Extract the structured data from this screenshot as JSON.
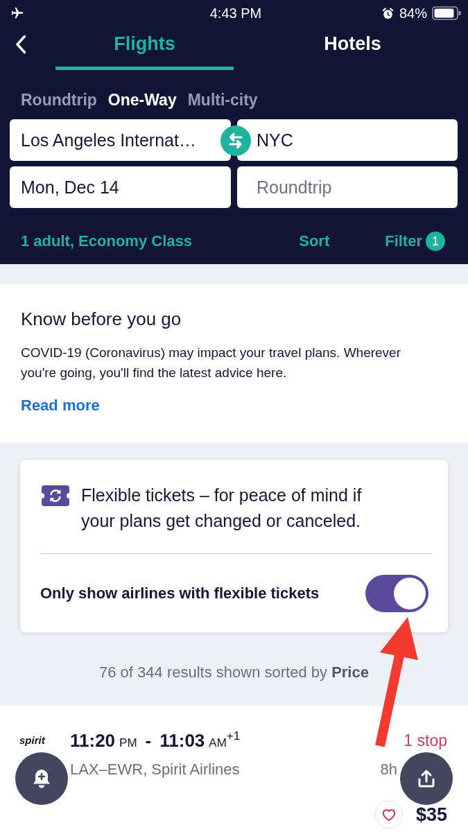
{
  "status_bar": {
    "time": "4:43 PM",
    "battery": "84%"
  },
  "header": {
    "tabs": [
      {
        "label": "Flights",
        "selected": true
      },
      {
        "label": "Hotels",
        "selected": false
      }
    ],
    "trip_types": [
      {
        "label": "Roundtrip",
        "selected": false
      },
      {
        "label": "One-Way",
        "selected": true
      },
      {
        "label": "Multi-city",
        "selected": false
      }
    ],
    "fields": {
      "origin": {
        "value": "Los Angeles Internat…"
      },
      "destination": {
        "value": "NYC"
      },
      "depart_date": {
        "value": "Mon, Dec 14"
      },
      "return_date": {
        "placeholder": "Roundtrip"
      }
    },
    "passengers": "1 adult, Economy Class",
    "sort": "Sort",
    "filter": {
      "label": "Filter",
      "count": "1"
    }
  },
  "notice": {
    "title": "Know before you go",
    "body": "COVID-19 (Coronavirus) may impact your travel plans. Wherever you're going, you'll find the latest advice here.",
    "link": "Read more"
  },
  "flexible_tickets": {
    "text": "Flexible tickets – for peace of mind if your plans get changed or canceled.",
    "toggle_label": "Only show airlines with flexible tickets",
    "on": true
  },
  "results_summary": "76 of 344 results shown sorted by **Price**",
  "results": [
    {
      "airline_logo": "spirit",
      "depart_time": "11:20",
      "depart_period": "PM",
      "separator": "-",
      "arrive_time": "11:03",
      "arrive_period": "AM",
      "day_offset": "+1",
      "stops": "1 stop",
      "route": "LAX–EWR, Spirit Airlines",
      "duration": "8h",
      "price": "$35",
      "favorite": false
    }
  ]
}
